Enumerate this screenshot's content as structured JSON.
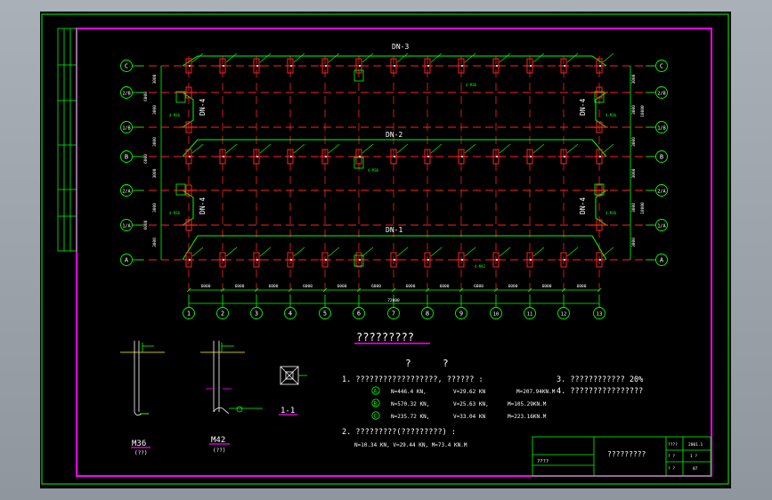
{
  "drawing": {
    "beams": [
      "DN-3",
      "DN-2",
      "DN-1"
    ],
    "side_beams": [
      "DN-4",
      "DN-4",
      "DN-4",
      "DN-4"
    ],
    "row_axes": [
      "C",
      "2/B",
      "1/B",
      "B",
      "2/A",
      "1/A",
      "A"
    ],
    "col_axes": [
      "1",
      "2",
      "3",
      "4",
      "5",
      "6",
      "7",
      "8",
      "9",
      "10",
      "11",
      "12",
      "13"
    ],
    "left_dims": [
      "3000",
      "3000",
      "3000",
      "3000",
      "3000",
      "3000"
    ],
    "left_totals": [
      "6000",
      "6000",
      "6000"
    ],
    "right_dims": [
      "3000",
      "3000",
      "3000",
      "3000",
      "3000",
      "3000"
    ],
    "right_totals": [
      "18000",
      "18000"
    ],
    "bottom_dims": [
      "6000",
      "6000",
      "6000",
      "6000",
      "6000",
      "6000",
      "6000",
      "6000",
      "6000",
      "6000",
      "6000",
      "6000"
    ],
    "bottom_total": "72000",
    "small_tag": "4-M36",
    "small_tag_b": "4-M42"
  },
  "notes": {
    "heading": "?????????",
    "q1": "?",
    "q2": "?",
    "item1": "1. ??????????????????, ?????? :",
    "A_row": [
      "N=446.4 KN,",
      "V=29.62 KN",
      "M=207.94KN.M"
    ],
    "B_row": [
      "N=570.32 KN,",
      "V=25.63 KN,",
      "M=105.29KN.M"
    ],
    "C_row": [
      "N=235.72 KN,",
      "V=33.04 KN",
      "M=223.16KN.M"
    ],
    "circ": [
      "A",
      "B",
      "C"
    ],
    "item2": "2. ?????????(?????????) :",
    "item2_vals": "N=10.34 KN,    V=29.44 KN,     M=73.4 KN.M",
    "item3": "3. ????????????   20%",
    "item4": "4. ????????????????"
  },
  "details": {
    "m36_label": "M36",
    "m36_sub": "(??)",
    "m42_label": "M42",
    "m42_sub": "(??)",
    "section_label": "1-1"
  },
  "titleblock": {
    "name": "?????????",
    "left_cell": "????",
    "r1": [
      "????",
      "2001.1"
    ],
    "r2": [
      "? ?",
      "1 ?"
    ],
    "r3": [
      "? ?",
      "07"
    ]
  }
}
